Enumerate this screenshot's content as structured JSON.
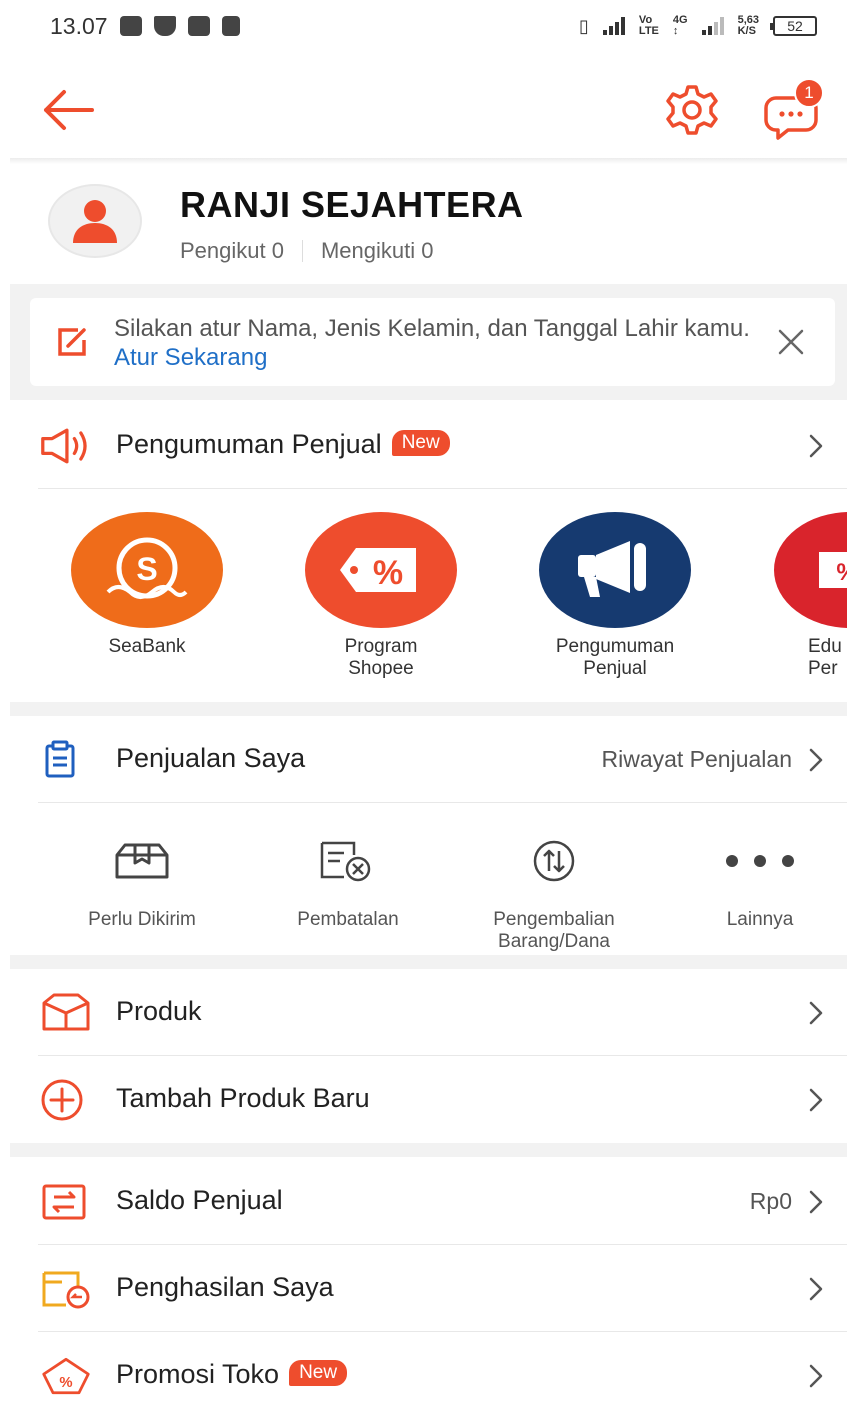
{
  "status_bar": {
    "time": "13.07",
    "network_speed": "5,63",
    "network_unit": "K/S",
    "volte": "Vo",
    "lte": "LTE",
    "four_g": "4G",
    "battery": "52"
  },
  "header": {
    "chat_badge_count": "1"
  },
  "profile": {
    "shop_name": "RANJI SEJAHTERA",
    "followers": "Pengikut 0",
    "following": "Mengikuti 0"
  },
  "notice": {
    "text": "Silakan atur Nama, Jenis Kelamin, dan Tanggal Lahir kamu.",
    "link": "Atur Sekarang"
  },
  "announcement": {
    "label": "Pengumuman Penjual",
    "badge": "New"
  },
  "carousel": [
    {
      "label_1": "SeaBank",
      "label_2": "",
      "color": "#ef6c1a",
      "icon": "seabank-icon"
    },
    {
      "label_1": "Program",
      "label_2": "Shopee",
      "color": "#ee4d2d",
      "icon": "discount-tag-icon"
    },
    {
      "label_1": "Pengumuman",
      "label_2": "Penjual",
      "color": "#163a70",
      "icon": "megaphone-icon"
    },
    {
      "label_1": "Edu",
      "label_2": "Per",
      "color": "#d9242c",
      "icon": "education-icon"
    }
  ],
  "my_sales": {
    "label": "Penjualan Saya",
    "right_label": "Riwayat Penjualan",
    "items": [
      {
        "line1": "Perlu Dikirim",
        "line2": ""
      },
      {
        "line1": "Pembatalan",
        "line2": ""
      },
      {
        "line1": "Pengembalian",
        "line2": "Barang/Dana"
      },
      {
        "line1": "Lainnya",
        "line2": ""
      }
    ]
  },
  "menu": {
    "products": "Produk",
    "add_product": "Tambah Produk Baru",
    "seller_balance": "Saldo Penjual",
    "seller_balance_value": "Rp0",
    "my_income": "Penghasilan Saya",
    "store_promo": "Promosi Toko",
    "store_promo_badge": "New"
  },
  "colors": {
    "accent": "#ee4d2d",
    "link": "#1f6fc7",
    "sales_icon": "#1f5fbf",
    "income_icon": "#f0a91f"
  }
}
